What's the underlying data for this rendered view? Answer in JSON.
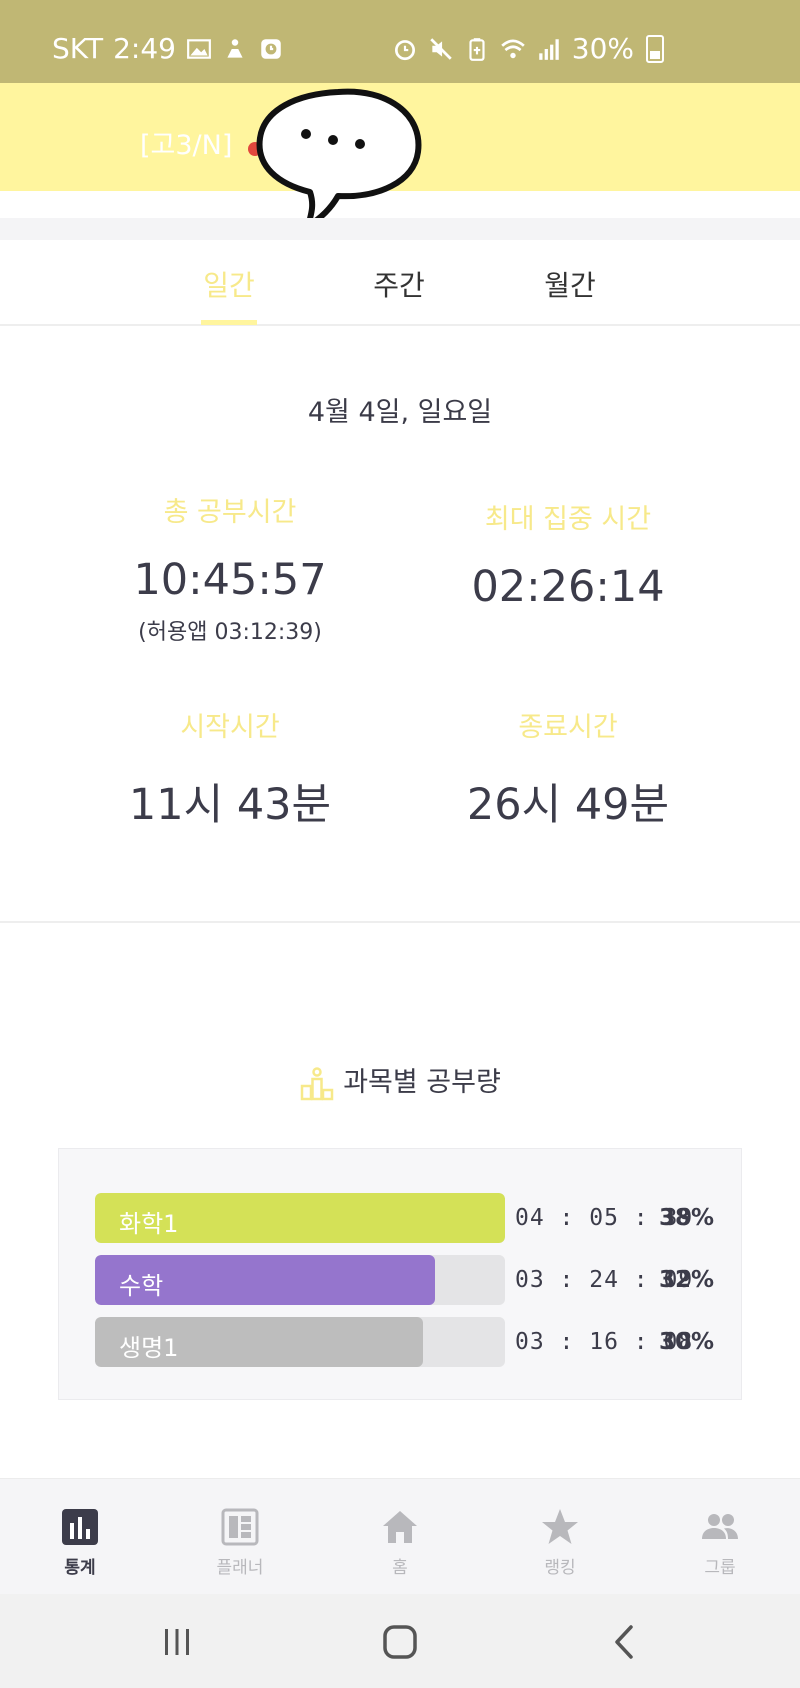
{
  "status_bar": {
    "carrier": "SKT",
    "time": "2:49",
    "battery": "30%",
    "icons_left": [
      "gallery-icon",
      "sport-icon",
      "clock-badge-icon"
    ],
    "icons_right": [
      "alarm-icon",
      "mute-icon",
      "battery-saver-icon",
      "wifi-icon",
      "signal-icon"
    ]
  },
  "header": {
    "title": "[고3/N]"
  },
  "tabs": [
    {
      "label": "일간",
      "active": true
    },
    {
      "label": "주간",
      "active": false
    },
    {
      "label": "월간",
      "active": false
    }
  ],
  "date": "4월 4일, 일요일",
  "stats": {
    "total_label": "총 공부시간",
    "total_value": "10:45:57",
    "total_sub": "(허용앱  03:12:39)",
    "max_focus_label": "최대 집중 시간",
    "max_focus_value": "02:26:14",
    "start_label": "시작시간",
    "start_value": "11시 43분",
    "end_label": "종료시간",
    "end_value": "26시 49분"
  },
  "subjects": {
    "title": "과목별 공부량",
    "items": [
      {
        "name": "화학1",
        "time": "04 : 05 : 39",
        "percent": "38%",
        "fill_fraction": 1.0,
        "color": "#d4e157"
      },
      {
        "name": "수학",
        "time": "03 : 24 : 09",
        "percent": "32%",
        "fill_fraction": 0.83,
        "color": "#9575cd"
      },
      {
        "name": "생명1",
        "time": "03 : 16 : 08",
        "percent": "30%",
        "fill_fraction": 0.8,
        "color": "#bdbdbd"
      }
    ]
  },
  "bottom_nav": [
    {
      "label": "통계",
      "icon": "bar-chart-icon",
      "active": true
    },
    {
      "label": "플래너",
      "icon": "planner-icon",
      "active": false
    },
    {
      "label": "홈",
      "icon": "home-icon",
      "active": false
    },
    {
      "label": "랭킹",
      "icon": "star-icon",
      "active": false
    },
    {
      "label": "그룹",
      "icon": "group-icon",
      "active": false
    }
  ],
  "colors": {
    "status_bar": "#c0b774",
    "header": "#fff59e",
    "accent_text": "#f7e98a",
    "dark_text": "#3c3c4a"
  }
}
